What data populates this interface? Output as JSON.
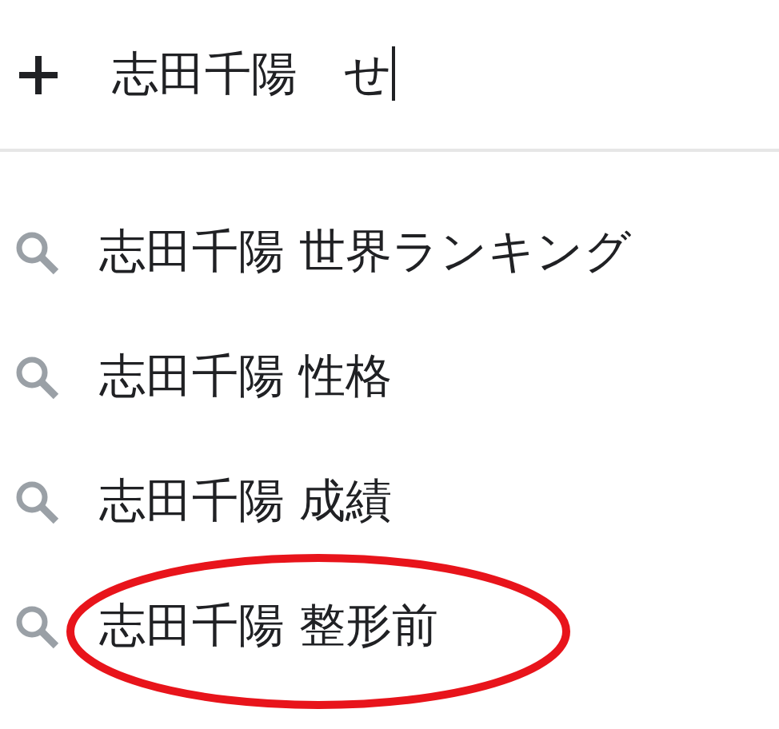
{
  "search": {
    "value": "志田千陽　せ",
    "focused": true
  },
  "suggestions": [
    {
      "text": "志田千陽 世界ランキング",
      "circled": false
    },
    {
      "text": "志田千陽 性格",
      "circled": false
    },
    {
      "text": "志田千陽 成績",
      "circled": false
    },
    {
      "text": "志田千陽 整形前",
      "circled": true
    }
  ]
}
